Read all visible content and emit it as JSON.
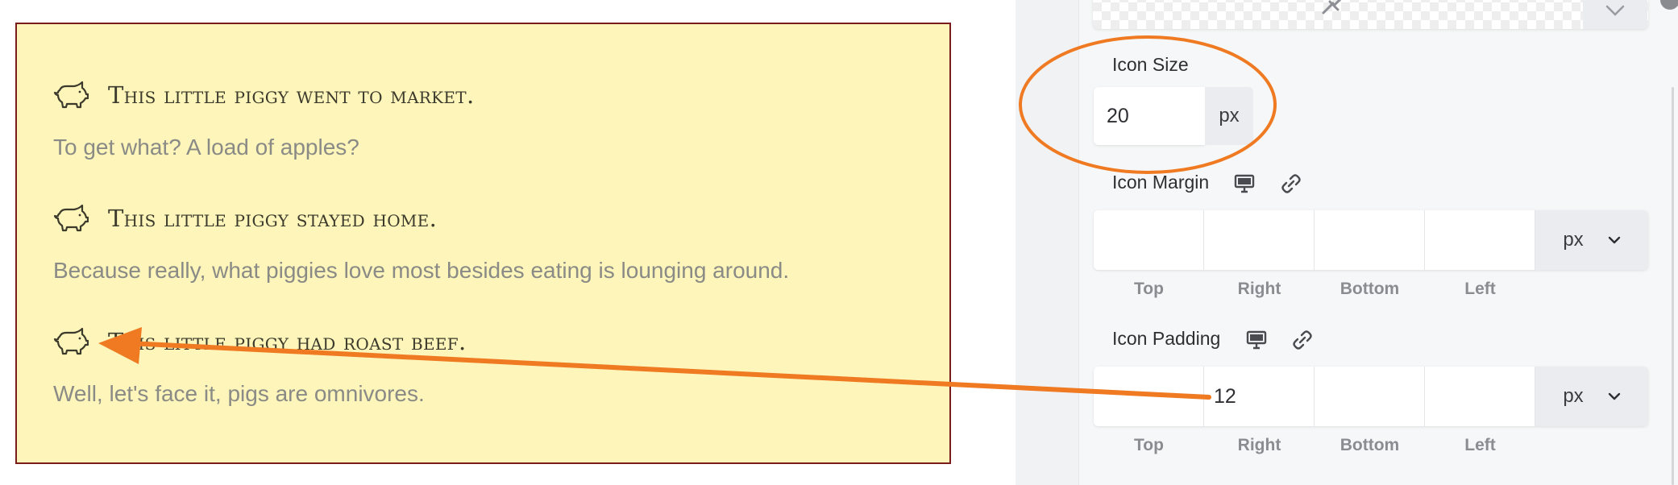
{
  "preview": {
    "items": [
      {
        "heading": "This little piggy went to market.",
        "body": "To get what? A load of apples?"
      },
      {
        "heading": "This little piggy stayed home.",
        "body": "Because really, what piggies love most besides eating is lounging around."
      },
      {
        "heading": "This little piggy had roast beef.",
        "body": "Well, let's face it, pigs are omnivores."
      }
    ],
    "icon": "pig-icon"
  },
  "settings": {
    "icon_size": {
      "label": "Icon Size",
      "value": "20",
      "unit": "px"
    },
    "icon_margin": {
      "label": "Icon Margin",
      "values": [
        "",
        "",
        "",
        ""
      ],
      "unit": "px",
      "sides": [
        "Top",
        "Right",
        "Bottom",
        "Left"
      ]
    },
    "icon_padding": {
      "label": "Icon Padding",
      "values": [
        "",
        "12",
        "",
        ""
      ],
      "unit": "px",
      "sides": [
        "Top",
        "Right",
        "Bottom",
        "Left"
      ]
    }
  },
  "colors": {
    "preview_bg": "#fdf5b9",
    "preview_border": "#7a1c1c",
    "annotation": "#ef7a22"
  }
}
